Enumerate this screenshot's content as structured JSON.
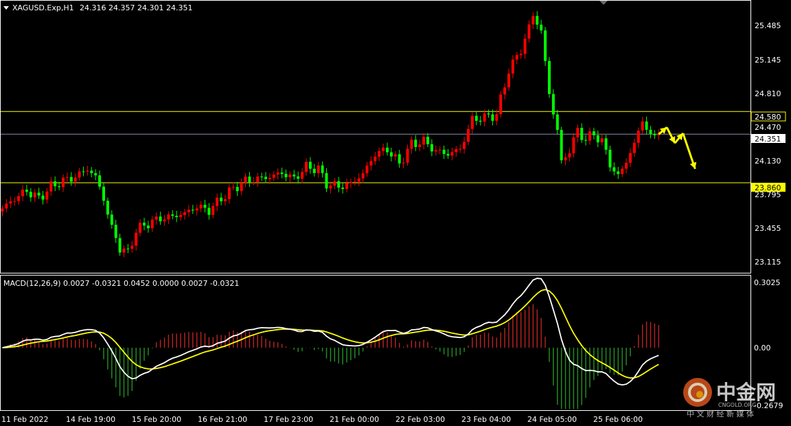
{
  "header": {
    "symbol": "XAGUSD.Exp,H1",
    "ohlc": "24.316 24.357 24.301 24.351"
  },
  "macd": {
    "label": "MACD(12,26,9) 0.0027 -0.0321 0.0452 0.0000 0.0027 -0.0321",
    "axis_labels": [
      "0.3025",
      "0.00",
      "-0.2679"
    ]
  },
  "price_axis": {
    "labels": [
      "25.485",
      "25.145",
      "24.810",
      "24.470",
      "24.130",
      "23.795",
      "23.455",
      "23.115"
    ]
  },
  "levels": {
    "resistance": "24.580",
    "current": "24.351",
    "support": "23.860"
  },
  "time_axis": {
    "labels": [
      "11 Feb 2022",
      "14 Feb 19:00",
      "15 Feb 20:00",
      "16 Feb 21:00",
      "17 Feb 23:00",
      "21 Feb 00:00",
      "22 Feb 03:00",
      "23 Feb 04:00",
      "24 Feb 05:00",
      "25 Feb 06:00"
    ]
  },
  "watermark": {
    "brand_cn": "中金网",
    "brand_en": "CNGOLD.ORG",
    "tagline": "中 文 财 经 新 媒 体"
  },
  "colors": {
    "up": "#ff0000",
    "down": "#00ff00",
    "level_line": "#ffff00",
    "current_line": "#8c8cb4",
    "signal": "#ffff00",
    "macd_line": "#ffffff",
    "hist_pos": "#b22222",
    "hist_neg": "#228b22"
  },
  "chart_data": {
    "type": "candlestick",
    "symbol": "XAGUSD.Exp",
    "timeframe": "H1",
    "ylim": [
      22.95,
      25.7
    ],
    "anchors": [
      [
        0,
        23.6
      ],
      [
        3,
        23.7
      ],
      [
        6,
        23.78
      ],
      [
        9,
        23.7
      ],
      [
        12,
        23.82
      ],
      [
        15,
        23.88
      ],
      [
        18,
        23.92
      ],
      [
        21,
        24.0
      ],
      [
        23,
        23.92
      ],
      [
        25,
        23.7
      ],
      [
        27,
        23.4
      ],
      [
        29,
        23.2
      ],
      [
        31,
        23.15
      ],
      [
        33,
        23.38
      ],
      [
        36,
        23.45
      ],
      [
        39,
        23.5
      ],
      [
        42,
        23.52
      ],
      [
        45,
        23.55
      ],
      [
        48,
        23.62
      ],
      [
        51,
        23.58
      ],
      [
        54,
        23.7
      ],
      [
        57,
        23.8
      ],
      [
        60,
        23.88
      ],
      [
        63,
        23.9
      ],
      [
        66,
        23.92
      ],
      [
        69,
        23.96
      ],
      [
        72,
        23.9
      ],
      [
        75,
        24.02
      ],
      [
        78,
        24.0
      ],
      [
        80,
        23.85
      ],
      [
        83,
        23.82
      ],
      [
        86,
        23.85
      ],
      [
        89,
        23.95
      ],
      [
        92,
        24.15
      ],
      [
        95,
        24.2
      ],
      [
        98,
        24.05
      ],
      [
        101,
        24.25
      ],
      [
        104,
        24.28
      ],
      [
        107,
        24.18
      ],
      [
        110,
        24.15
      ],
      [
        113,
        24.2
      ],
      [
        116,
        24.5
      ],
      [
        119,
        24.52
      ],
      [
        122,
        24.55
      ],
      [
        125,
        25.0
      ],
      [
        128,
        25.2
      ],
      [
        131,
        25.55
      ],
      [
        133,
        25.4
      ],
      [
        135,
        24.75
      ],
      [
        137,
        24.4
      ],
      [
        138,
        24.05
      ],
      [
        140,
        24.2
      ],
      [
        142,
        24.38
      ],
      [
        144,
        24.3
      ],
      [
        146,
        24.35
      ],
      [
        148,
        24.28
      ],
      [
        150,
        24.05
      ],
      [
        152,
        23.92
      ],
      [
        154,
        24.08
      ],
      [
        156,
        24.25
      ],
      [
        158,
        24.5
      ],
      [
        160,
        24.32
      ],
      [
        162,
        24.351
      ]
    ],
    "horizontal_levels": [
      24.58,
      24.351,
      23.86
    ],
    "projection_arrows": [
      [
        162,
        24.35
      ],
      [
        164,
        24.42
      ],
      [
        166,
        24.26
      ],
      [
        168,
        24.36
      ],
      [
        171,
        24.0
      ]
    ]
  }
}
